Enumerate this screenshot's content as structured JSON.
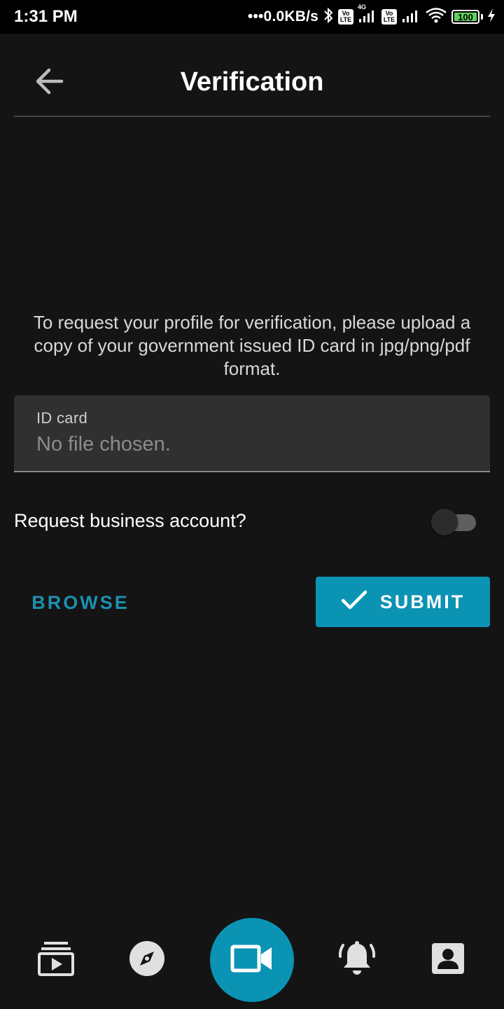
{
  "status_bar": {
    "time": "1:31 PM",
    "network_speed": "•••0.0KB/s",
    "volte_1": "Vo LTE",
    "volte_2": "Vo LTE",
    "network_type": "4G",
    "battery_level": "100",
    "icons": [
      "bluetooth-icon",
      "signal-icon",
      "wifi-icon",
      "battery-icon",
      "charging-icon"
    ]
  },
  "header": {
    "title": "Verification",
    "back_icon": "arrow-left-icon"
  },
  "main": {
    "instructions": "To request your profile for verification, please upload a copy of your government issued ID card in jpg/png/pdf format.",
    "id_field": {
      "label": "ID card",
      "value": "No file chosen."
    },
    "business_toggle": {
      "label": "Request business account?",
      "checked": false
    },
    "browse_label": "BROWSE",
    "submit_label": "SUBMIT",
    "submit_icon": "check-icon"
  },
  "bottom_nav": {
    "items": [
      {
        "icon": "playlist-play-icon"
      },
      {
        "icon": "compass-icon"
      },
      {
        "icon": "video-camera-icon"
      },
      {
        "icon": "bell-ringing-icon"
      },
      {
        "icon": "account-box-icon"
      }
    ]
  },
  "colors": {
    "background": "#141414",
    "accent": "#0b93b4",
    "accent_text": "#1d8fb0",
    "field_background": "#303030"
  }
}
